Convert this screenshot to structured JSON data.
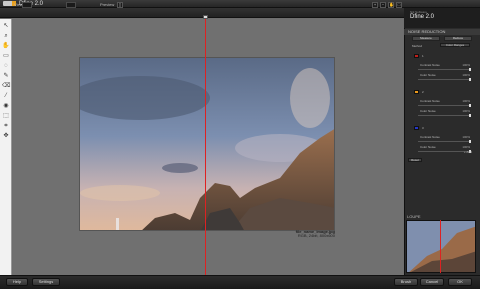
{
  "window": {
    "title": "Dfine 2.0"
  },
  "toolbar": {
    "view_label": "View",
    "zoom_label": "Zoom",
    "preview_label": "Preview",
    "icons": [
      "zoom-in-icon",
      "zoom-out-icon",
      "hand-icon",
      "fit-icon",
      "loupe-icon"
    ]
  },
  "tools": [
    "arrow",
    "zoom",
    "hand",
    "rect",
    "lasso",
    "brush",
    "eraser",
    "eyedropper",
    "fill",
    "rect-select",
    "crop",
    "move"
  ],
  "image": {
    "caption_name": "file_name_image.jpg",
    "caption_meta": "RGB, 24bit, 800x600"
  },
  "panel": {
    "subtitle": "Nik Software",
    "title": "Dfine 2.0",
    "section": "NOISE REDUCTION",
    "tabs": [
      "Measure",
      "Reduce"
    ],
    "method_label": "Method",
    "method_value": "Color Ranges",
    "groups": [
      {
        "color": "#c0201b",
        "label": "1",
        "rows": [
          {
            "label": "Contrast Noise",
            "value": "100%"
          },
          {
            "label": "Color Noise",
            "value": "100%"
          }
        ]
      },
      {
        "color": "#e8981c",
        "label": "2",
        "rows": [
          {
            "label": "Contrast Noise",
            "value": "100%"
          },
          {
            "label": "Color Noise",
            "value": "100%"
          }
        ]
      },
      {
        "color": "#2538c8",
        "label": "3",
        "rows": [
          {
            "label": "Contrast Noise",
            "value": "100%"
          },
          {
            "label": "Color Noise",
            "value": "100%"
          }
        ]
      }
    ],
    "add_label": "+ Add",
    "reset_label": "Reset",
    "loupe_label": "LOUPE"
  },
  "bottom": {
    "help": "Help",
    "settings": "Settings",
    "brush": "Brush",
    "cancel": "Cancel",
    "ok": "OK"
  }
}
